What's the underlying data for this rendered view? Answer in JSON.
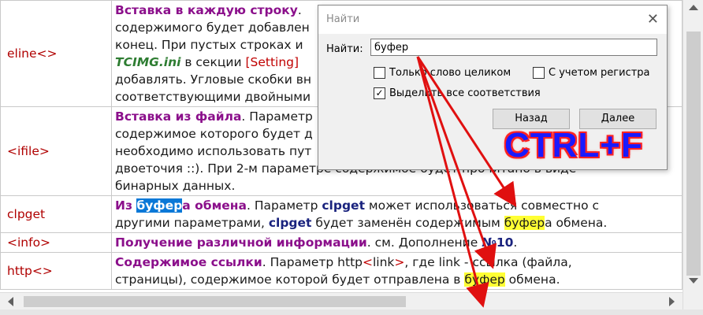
{
  "rows": [
    {
      "param": "eline<>",
      "lines": [
        {
          "title": "Вставка в каждую строку",
          "text": "."
        },
        {
          "text": "содержимого будет добавлен"
        },
        {
          "text": "конец. При пустых строках и"
        },
        {
          "ini": "TCIMG.ini",
          "text1": " в секции ",
          "setting": "[Setting]",
          "text2": ""
        },
        {
          "text": "добавлять. Угловые скобки вн"
        },
        {
          "text": "соответствующими двойными"
        }
      ]
    },
    {
      "param": "<ifile>",
      "lines": [
        {
          "title": "Вставка из файла",
          "text": ". Параметр"
        },
        {
          "text": "содержимое которого будет д"
        },
        {
          "text": "необходимо использовать пут"
        },
        {
          "text": "двоеточия ::). При 2-м параметре содержимое будет прочитано в виде"
        },
        {
          "text": "бинарных данных."
        }
      ]
    },
    {
      "param": "clpget",
      "lines": [
        {
          "pre": "Из ",
          "sel": "буфер",
          "titlerest": "а обмена",
          "text": ". Параметр ",
          "kw": "clpget",
          "text2": " может использоваться совместно с"
        },
        {
          "text": "другими параметрами, ",
          "kw": "clpget",
          "text2": " будет заменён содержимым ",
          "hl": "буфер",
          "text3": "а обмена."
        }
      ]
    },
    {
      "param": "<info>",
      "lines": [
        {
          "title": "Получение различной информации",
          "text": ". см. Дополнение ",
          "num": "№10",
          "text2": "."
        }
      ]
    },
    {
      "param": "http<>",
      "lines": [
        {
          "title": "Содержимое ссылки",
          "text": ". Параметр http",
          "lt": "<",
          "link": "link",
          "gt": ">",
          "text2": ", где link - ссылка (файла,"
        },
        {
          "text": "страницы), содержимое которой будет отправлена в ",
          "hl": "буфер",
          "text3": " обмена."
        }
      ]
    }
  ],
  "dialog": {
    "title": "Найти",
    "find_label": "Найти:",
    "find_value": "буфер",
    "whole_word": {
      "label": "Только слово целиком",
      "checked": false
    },
    "match_case": {
      "label": "С учетом регистра",
      "checked": false
    },
    "highlight_all": {
      "label": "Выделить все соответствия",
      "checked": true
    },
    "back_label": "Назад",
    "next_label": "Далее",
    "close_glyph": "✕"
  },
  "overlay_text": "CTRL+F",
  "colors": {
    "title_purple": "#8b0f8b",
    "param_red": "#b00000",
    "keyword_navy": "#1a237e",
    "ini_green": "#2e7d32",
    "highlight_yellow": "#ffff33",
    "selection_blue": "#0a78d7",
    "arrow_red": "#e01010"
  }
}
